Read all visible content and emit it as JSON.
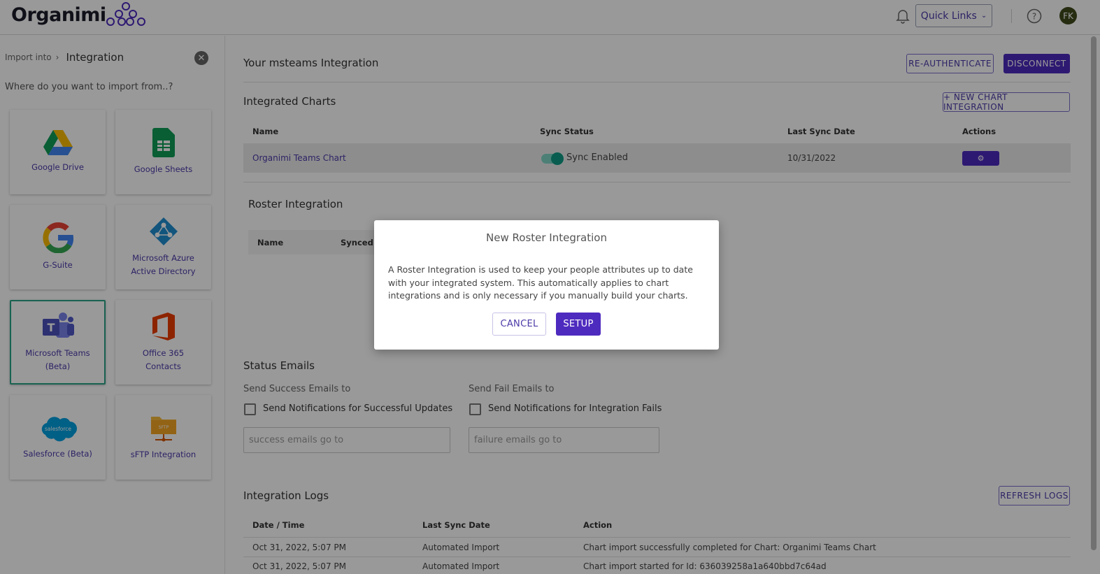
{
  "header": {
    "logo_text": "Organimi",
    "quick_links_label": "Quick Links",
    "avatar_initials": "FK"
  },
  "sidebar": {
    "breadcrumb_parent": "Import into",
    "breadcrumb_current": "Integration",
    "prompt": "Where do you want to import from..?",
    "sources": [
      {
        "label": "Google Drive",
        "icon": "google-drive-icon"
      },
      {
        "label": "Google Sheets",
        "icon": "google-sheets-icon"
      },
      {
        "label": "G-Suite",
        "icon": "google-g-icon"
      },
      {
        "label": "Microsoft Azure Active Directory",
        "icon": "azure-ad-icon"
      },
      {
        "label": "Microsoft Teams (Beta)",
        "icon": "microsoft-teams-icon",
        "selected": true
      },
      {
        "label": "Office 365 Contacts",
        "icon": "office-365-icon"
      },
      {
        "label": "Salesforce (Beta)",
        "icon": "salesforce-icon"
      },
      {
        "label": "sFTP Integration",
        "icon": "sftp-folder-icon"
      }
    ]
  },
  "main": {
    "title": "Your msteams Integration",
    "reauth_label": "RE-AUTHENTICATE",
    "disconnect_label": "DISCONNECT",
    "integrated_charts": {
      "heading": "Integrated Charts",
      "new_chart_label": "+ NEW CHART INTEGRATION",
      "columns": [
        "Name",
        "Sync Status",
        "Last Sync Date",
        "Actions"
      ],
      "rows": [
        {
          "name": "Organimi Teams Chart",
          "sync_status": "Sync Enabled",
          "last_sync": "10/31/2022"
        }
      ]
    },
    "roster": {
      "heading": "Roster Integration",
      "columns": [
        "Name",
        "Synced"
      ]
    },
    "status_emails": {
      "heading": "Status Emails",
      "success_label": "Send Success Emails to",
      "fail_label": "Send Fail Emails to",
      "success_checkbox": "Send Notifications for Successful Updates",
      "fail_checkbox": "Send Notifications for Integration Fails",
      "success_placeholder": "success emails go to",
      "fail_placeholder": "failure emails go to"
    },
    "logs": {
      "heading": "Integration Logs",
      "refresh_label": "REFRESH LOGS",
      "columns": [
        "Date / Time",
        "Last Sync Date",
        "Action"
      ],
      "rows": [
        {
          "datetime": "Oct 31, 2022, 5:07 PM",
          "type": "Automated Import",
          "action": "Chart import successfully completed for Chart: Organimi Teams Chart"
        },
        {
          "datetime": "Oct 31, 2022, 5:07 PM",
          "type": "Automated Import",
          "action": "Chart import started for Id: 636039258a1a640bbd7c64ad"
        }
      ]
    }
  },
  "modal": {
    "title": "New Roster Integration",
    "body": "A Roster Integration is used to keep your people attributes up to date with your integrated system. This automatically applies to chart integrations and is only necessary if you manually build your charts.",
    "cancel_label": "CANCEL",
    "setup_label": "SETUP"
  },
  "colors": {
    "accent": "#4e2bbf",
    "toggle_on": "#0f9c86",
    "selected_border": "#2aa388"
  }
}
